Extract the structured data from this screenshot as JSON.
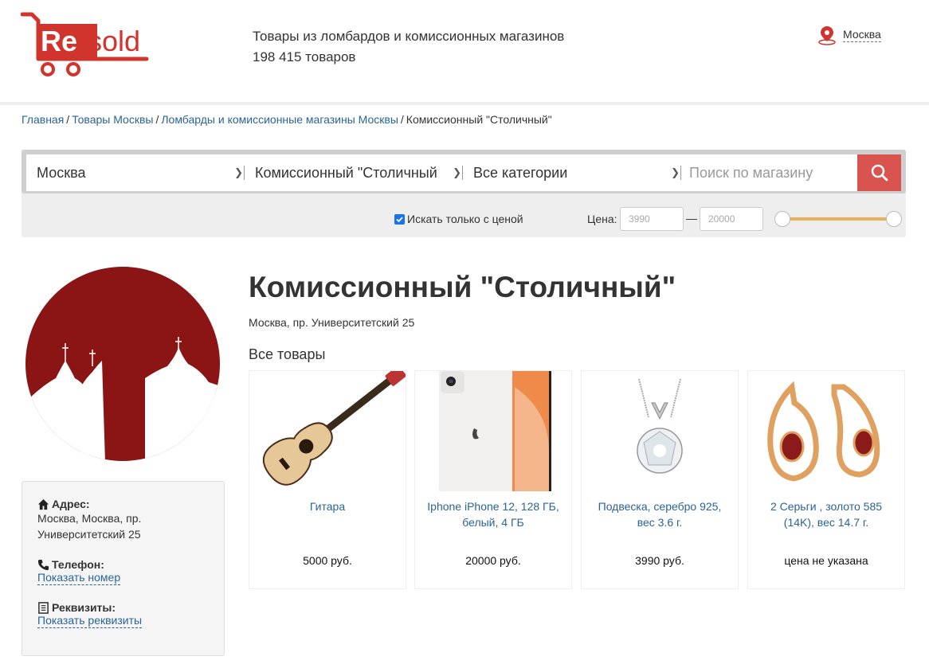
{
  "header": {
    "logo_text_re": "Re",
    "logo_text_sold": "sold",
    "tagline_line1": "Товары из ломбардов и комиссионных магазинов",
    "tagline_line2": "198 415 товаров",
    "city": "Москва"
  },
  "breadcrumb": {
    "items": [
      "Главная",
      "Товары Москвы",
      "Ломбарды и комиссионные магазины Москвы"
    ],
    "current": "Комиссионный \"Столичный\"",
    "separator": "/"
  },
  "search": {
    "city_select": "Москва",
    "shop_select": "Комиссионный \"Столичный",
    "category_select": "Все категории",
    "placeholder": "Поиск по магазину",
    "only_with_price_label": "Искать только с ценой",
    "only_with_price_checked": true,
    "price_label": "Цена:",
    "price_min": "3990",
    "price_max": "20000",
    "price_dash": "—"
  },
  "shop": {
    "title": "Комиссионный \"Столичный\"",
    "address": "Москва, пр. Университетский 25",
    "section_title": "Все товары"
  },
  "info": {
    "address_label": "Адрес:",
    "address_line1": "Москва, Москва, пр.",
    "address_line2": "Университетский 25",
    "phone_label": "Телефон:",
    "phone_link": "Показать номер",
    "requisites_label": "Реквизиты:",
    "requisites_link": "Показать реквизиты"
  },
  "products": [
    {
      "name": "Гитара",
      "price": "5000 руб."
    },
    {
      "name": "Iphone iPhone 12, 128 ГБ, белый, 4 ГБ",
      "price": "20000 руб."
    },
    {
      "name": "Подвеска, серебро 925, вес 3.6 г.",
      "price": "3990 руб."
    },
    {
      "name": "2 Серьги , золото 585 (14K), вес 14.7 г.",
      "price": "цена не указана"
    }
  ],
  "colors": {
    "brand_red": "#d0342c",
    "link_blue": "#2a6496",
    "search_button": "#d9534f",
    "slider": "#e8b25a",
    "shop_logo": "#8b1414"
  },
  "icons": [
    "cart-logo-icon",
    "location-pin-icon",
    "search-icon",
    "chevron-down-icon",
    "home-icon",
    "phone-icon",
    "document-icon",
    "checkmark-icon"
  ]
}
